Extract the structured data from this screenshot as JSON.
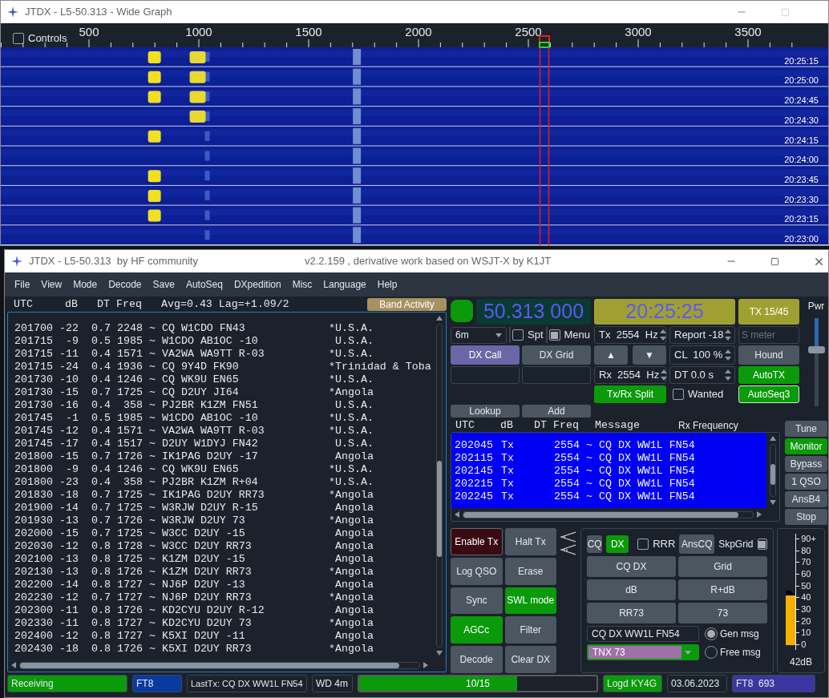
{
  "wide_graph": {
    "title": "JTDX - L5-50.313 - Wide Graph",
    "controls": {
      "label": "Controls",
      "checked": false
    },
    "scale": [
      "500",
      "1000",
      "1500",
      "2000",
      "2500",
      "3000",
      "3500"
    ],
    "times": [
      "20:25:15",
      "20:25:00",
      "20:24:45",
      "20:24:30",
      "20:24:15",
      "20:24:00",
      "20:23:45",
      "20:23:30",
      "20:23:15",
      "20:23:00"
    ]
  },
  "main_window": {
    "title": "JTDX - L5-50.313  by HF community",
    "subtitle": "v2.2.159 , derivative work based on WSJT-X by K1JT"
  },
  "menu": [
    "File",
    "View",
    "Mode",
    "Decode",
    "Save",
    "AutoSeq",
    "DXpedition",
    "Misc",
    "Language",
    "Help"
  ],
  "band_activity": {
    "columns": [
      "UTC",
      "dB",
      "DT",
      "Freq"
    ],
    "stats": "Avg=0.43 Lag=+1.09/2",
    "button": "Band Activity",
    "rows": [
      {
        "utc": "201700",
        "db": "-22",
        "dt": "0.7",
        "freq": "2248",
        "sep": "~",
        "message": "CQ W1CDO FN43",
        "mark": "*",
        "country": "U.S.A."
      },
      {
        "utc": "201715",
        "db": "-9",
        "dt": "0.5",
        "freq": "1985",
        "sep": "~",
        "message": "W1CDO AB1OC -10",
        "country": "U.S.A."
      },
      {
        "utc": "201715",
        "db": "-11",
        "dt": "0.4",
        "freq": "1571",
        "sep": "~",
        "message": "VA2WA WA9TT R-03",
        "mark": "*",
        "country": "U.S.A."
      },
      {
        "utc": "201715",
        "db": "-24",
        "dt": "0.4",
        "freq": "1936",
        "sep": "~",
        "message": "CQ 9Y4D FK90",
        "mark": "*",
        "country": "Trinidad & Toba"
      },
      {
        "utc": "201730",
        "db": "-10",
        "dt": "0.4",
        "freq": "1246",
        "sep": "~",
        "message": "CQ WK9U EN65",
        "mark": "*",
        "country": "U.S.A."
      },
      {
        "utc": "201730",
        "db": "-15",
        "dt": "0.7",
        "freq": "1725",
        "sep": "~",
        "message": "CQ D2UY JI64",
        "mark": "*",
        "country": "Angola"
      },
      {
        "utc": "201730",
        "db": "-16",
        "dt": "0.4",
        "freq": "358",
        "sep": "~",
        "message": "PJ2BR K1ZM FN51",
        "country": "U.S.A."
      },
      {
        "utc": "201745",
        "db": "-1",
        "dt": "0.5",
        "freq": "1985",
        "sep": "~",
        "message": "W1CDO AB1OC -10",
        "mark": "*",
        "country": "U.S.A."
      },
      {
        "utc": "201745",
        "db": "-12",
        "dt": "0.4",
        "freq": "1571",
        "sep": "~",
        "message": "VA2WA WA9TT R-03",
        "mark": "*",
        "country": "U.S.A."
      },
      {
        "utc": "201745",
        "db": "-17",
        "dt": "0.4",
        "freq": "1517",
        "sep": "~",
        "message": "D2UY W1DYJ FN42",
        "country": "U.S.A."
      },
      {
        "utc": "201800",
        "db": "-15",
        "dt": "0.7",
        "freq": "1726",
        "sep": "~",
        "message": "IK1PAG D2UY -17",
        "country": "Angola"
      },
      {
        "utc": "201800",
        "db": "-9",
        "dt": "0.4",
        "freq": "1246",
        "sep": "~",
        "message": "CQ WK9U EN65",
        "mark": "*",
        "country": "U.S.A."
      },
      {
        "utc": "201800",
        "db": "-23",
        "dt": "0.4",
        "freq": "358",
        "sep": "~",
        "message": "PJ2BR K1ZM R+04",
        "mark": "*",
        "country": "U.S.A."
      },
      {
        "utc": "201830",
        "db": "-18",
        "dt": "0.7",
        "freq": "1725",
        "sep": "~",
        "message": "IK1PAG D2UY RR73",
        "mark": "*",
        "country": "Angola"
      },
      {
        "utc": "201900",
        "db": "-14",
        "dt": "0.7",
        "freq": "1725",
        "sep": "~",
        "message": "W3RJW D2UY R-15",
        "country": "Angola"
      },
      {
        "utc": "201930",
        "db": "-13",
        "dt": "0.7",
        "freq": "1726",
        "sep": "~",
        "message": "W3RJW D2UY 73",
        "mark": "*",
        "country": "Angola"
      },
      {
        "utc": "202000",
        "db": "-15",
        "dt": "0.7",
        "freq": "1725",
        "sep": "~",
        "message": "W3CC D2UY -15",
        "country": "Angola"
      },
      {
        "utc": "202030",
        "db": "-12",
        "dt": "0.8",
        "freq": "1728",
        "sep": "~",
        "message": "W3CC D2UY RR73",
        "country": "Angola"
      },
      {
        "utc": "202100",
        "db": "-13",
        "dt": "0.8",
        "freq": "1725",
        "sep": "~",
        "message": "K1ZM D2UY -15",
        "country": "Angola"
      },
      {
        "utc": "202130",
        "db": "-13",
        "dt": "0.8",
        "freq": "1726",
        "sep": "~",
        "message": "K1ZM D2UY RR73",
        "mark": "*",
        "country": "Angola"
      },
      {
        "utc": "202200",
        "db": "-14",
        "dt": "0.8",
        "freq": "1727",
        "sep": "~",
        "message": "NJ6P D2UY -13",
        "country": "Angola"
      },
      {
        "utc": "202230",
        "db": "-12",
        "dt": "0.7",
        "freq": "1727",
        "sep": "~",
        "message": "NJ6P D2UY RR73",
        "mark": "*",
        "country": "Angola"
      },
      {
        "utc": "202300",
        "db": "-11",
        "dt": "0.8",
        "freq": "1726",
        "sep": "~",
        "message": "KD2CYU D2UY R-12",
        "country": "Angola"
      },
      {
        "utc": "202330",
        "db": "-11",
        "dt": "0.8",
        "freq": "1727",
        "sep": "~",
        "message": "KD2CYU D2UY 73",
        "mark": "*",
        "country": "Angola"
      },
      {
        "utc": "202400",
        "db": "-12",
        "dt": "0.8",
        "freq": "1727",
        "sep": "~",
        "message": "K5XI D2UY -11",
        "country": "Angola"
      },
      {
        "utc": "202430",
        "db": "-18",
        "dt": "0.8",
        "freq": "1726",
        "sep": "~",
        "message": "K5XI D2UY RR73",
        "mark": "*",
        "country": "Angola"
      }
    ]
  },
  "dial": {
    "frequency": "50.313 000",
    "clock": "20:25:25",
    "tx_period": "TX 15/45"
  },
  "band": "6m",
  "spt": {
    "label": "Spt",
    "checked": false
  },
  "menu_toggle": {
    "label": "Menu",
    "checked": true
  },
  "dx_call": "DX Call",
  "dx_grid": "DX Grid",
  "lookup": "Lookup",
  "add": "Add",
  "tx_freq": "Tx  2554  Hz",
  "report": "Report -18",
  "s_meter": {
    "placeholder": "S meter"
  },
  "up": "▲",
  "down": "▼",
  "cl": "CL  100 %",
  "rx_freq": "Rx  2554  Hz",
  "dt": "DT 0.0 s",
  "hound": {
    "label": "Hound",
    "on": false
  },
  "auto_tx": {
    "label": "AutoTX",
    "on": true
  },
  "split": {
    "label": "Tx/Rx Split",
    "on": true
  },
  "wanted": {
    "label": "Wanted",
    "checked": false
  },
  "auto_seq": {
    "label": "AutoSeq3",
    "on": true
  },
  "rx_frequency": {
    "columns": [
      "UTC",
      "dB",
      "DT",
      "Freq",
      "Message",
      "Rx Frequency"
    ],
    "rows": [
      {
        "utc": "202045",
        "db": "Tx",
        "freq": "2554",
        "sep": "~",
        "message": "CQ DX WW1L FN54"
      },
      {
        "utc": "202115",
        "db": "Tx",
        "freq": "2554",
        "sep": "~",
        "message": "CQ DX WW1L FN54"
      },
      {
        "utc": "202145",
        "db": "Tx",
        "freq": "2554",
        "sep": "~",
        "message": "CQ DX WW1L FN54"
      },
      {
        "utc": "202215",
        "db": "Tx",
        "freq": "2554",
        "sep": "~",
        "message": "CQ DX WW1L FN54"
      },
      {
        "utc": "202245",
        "db": "Tx",
        "freq": "2554",
        "sep": "~",
        "message": "CQ DX WW1L FN54"
      }
    ]
  },
  "side_buttons": [
    {
      "label": "Tune",
      "on": false
    },
    {
      "label": "Monitor",
      "on": true
    },
    {
      "label": "Bypass",
      "on": false
    },
    {
      "label": "1 QSO",
      "on": false
    },
    {
      "label": "AnsB4",
      "on": false
    },
    {
      "label": "Stop",
      "on": false
    }
  ],
  "control_buttons": [
    {
      "label": "Enable Tx",
      "kind": "tx",
      "on": false
    },
    {
      "label": "Halt Tx",
      "kind": "plain",
      "on": false
    },
    {
      "label": "Log QSO",
      "kind": "plain",
      "on": false
    },
    {
      "label": "Erase",
      "kind": "plain",
      "on": false
    },
    {
      "label": "Sync",
      "kind": "plain",
      "on": false
    },
    {
      "label": "SWL mode",
      "kind": "plain",
      "on": true
    },
    {
      "label": "AGCc",
      "kind": "plain",
      "on": true
    },
    {
      "label": "Filter",
      "kind": "plain",
      "on": false
    },
    {
      "label": "Decode",
      "kind": "plain",
      "on": false
    },
    {
      "label": "Clear DX",
      "kind": "plain",
      "on": false
    }
  ],
  "messages": {
    "cq": {
      "label": "CQ",
      "on": false
    },
    "dx": {
      "label": "DX",
      "on": true
    },
    "rrr": {
      "label": "RRR",
      "checked": false
    },
    "ans_cq": "AnsCQ",
    "skp_grid": {
      "label": "SkpGrid",
      "checked": true
    },
    "buttons": [
      "CQ DX",
      "Grid",
      "dB",
      "R+dB",
      "RR73",
      "73"
    ],
    "gen_msg": "CQ DX WW1L FN54",
    "free_msg": "TNX 73",
    "radios": [
      {
        "label": "Gen msg",
        "selected": true
      },
      {
        "label": "Free msg",
        "selected": false
      }
    ]
  },
  "meter": {
    "ticks": [
      "90+",
      "80",
      "70",
      "60",
      "50",
      "40",
      "30",
      "20",
      "10",
      "0"
    ],
    "level": 0.47,
    "reading": "42dB"
  },
  "power": {
    "label": "Pwr",
    "level": 0.65
  },
  "status_bar": {
    "state": "Receiving",
    "mode": "FT8",
    "last_tx": "LastTx: CQ DX WW1L FN54",
    "wd": "WD 4m",
    "progress": {
      "text": "10/15",
      "level": 0.667
    },
    "logged": "Logd KY4G",
    "date": "03.06.2023",
    "mode_count": "FT8  693"
  }
}
